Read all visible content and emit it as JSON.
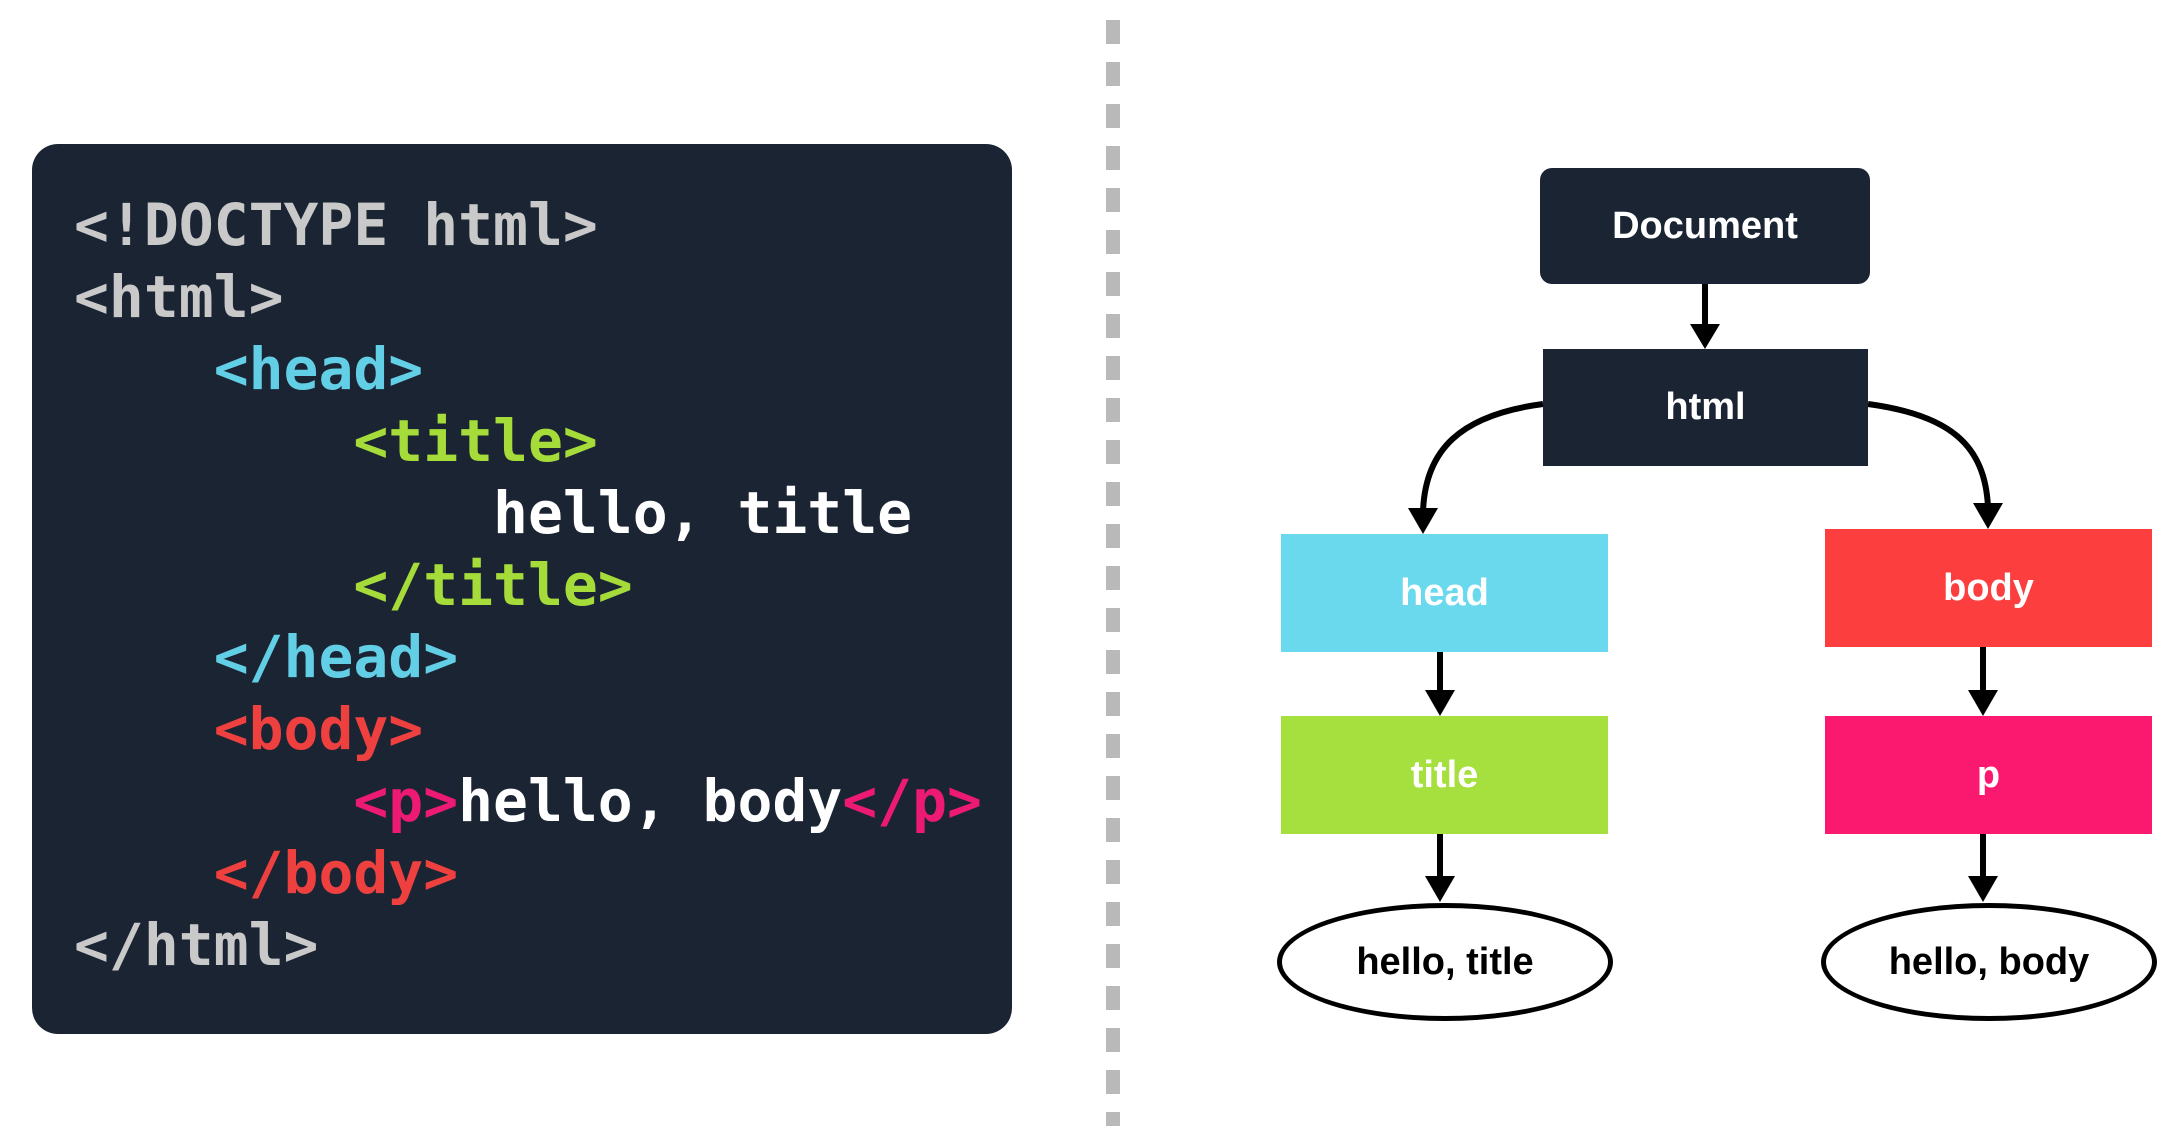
{
  "code": {
    "lines": [
      [
        {
          "t": "<!DOCTYPE html>",
          "c": "plain"
        }
      ],
      [
        {
          "t": "<html>",
          "c": "plain"
        }
      ],
      [
        {
          "t": "    ",
          "c": "plain"
        },
        {
          "t": "<head>",
          "c": "head"
        }
      ],
      [
        {
          "t": "        ",
          "c": "plain"
        },
        {
          "t": "<title>",
          "c": "title"
        }
      ],
      [
        {
          "t": "            ",
          "c": "plain"
        },
        {
          "t": "hello, title",
          "c": "text"
        }
      ],
      [
        {
          "t": "        ",
          "c": "plain"
        },
        {
          "t": "</title>",
          "c": "title"
        }
      ],
      [
        {
          "t": "    ",
          "c": "plain"
        },
        {
          "t": "</head>",
          "c": "head"
        }
      ],
      [
        {
          "t": "    ",
          "c": "plain"
        },
        {
          "t": "<body>",
          "c": "body"
        }
      ],
      [
        {
          "t": "        ",
          "c": "plain"
        },
        {
          "t": "<p>",
          "c": "p"
        },
        {
          "t": "hello, body",
          "c": "text"
        },
        {
          "t": "</p>",
          "c": "p"
        }
      ],
      [
        {
          "t": "    ",
          "c": "plain"
        },
        {
          "t": "</body>",
          "c": "body"
        }
      ],
      [
        {
          "t": "</html>",
          "c": "plain"
        }
      ]
    ]
  },
  "tree": {
    "document": "Document",
    "html": "html",
    "head": "head",
    "body": "body",
    "title": "title",
    "p": "p",
    "hello_title": "hello, title",
    "hello_body": "hello, body"
  },
  "colors": {
    "panel_background": "#1b2433",
    "plain": "#c9c9c9",
    "head": "#63cfe6",
    "title": "#a6dc3a",
    "body": "#ef4040",
    "p": "#ed1a73",
    "text": "#ffffff",
    "divider": "#b9b9b9"
  }
}
